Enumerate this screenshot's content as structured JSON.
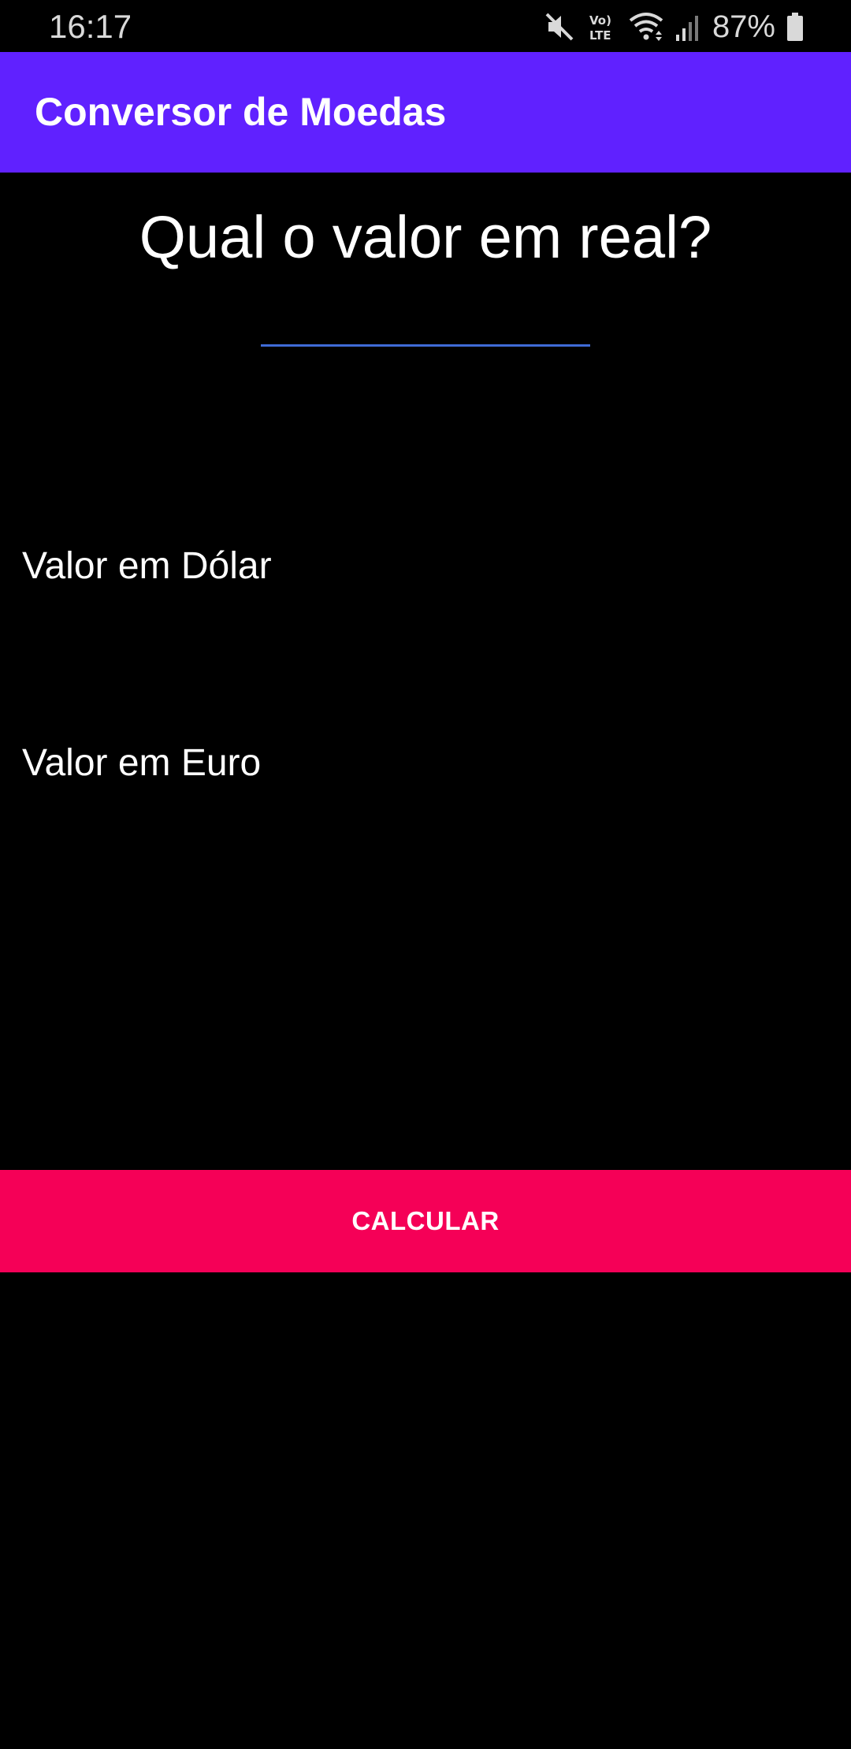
{
  "status_bar": {
    "time": "16:17",
    "battery_percent": "87%",
    "icons": [
      "mute-icon",
      "volte-icon",
      "wifi-icon",
      "signal-icon",
      "battery-icon"
    ],
    "volte_text": "Vo) LTE"
  },
  "app_bar": {
    "title": "Conversor de Moedas",
    "color": "#6021FF"
  },
  "main": {
    "question": "Qual o valor em real?",
    "input": {
      "value": "",
      "placeholder": "",
      "underline_color": "#3F6BD6"
    },
    "dollar_label": "Valor em Dólar",
    "euro_label": "Valor em Euro",
    "calculate_button": {
      "label": "CALCULAR",
      "color": "#F50057"
    }
  },
  "background_color": "#000000"
}
